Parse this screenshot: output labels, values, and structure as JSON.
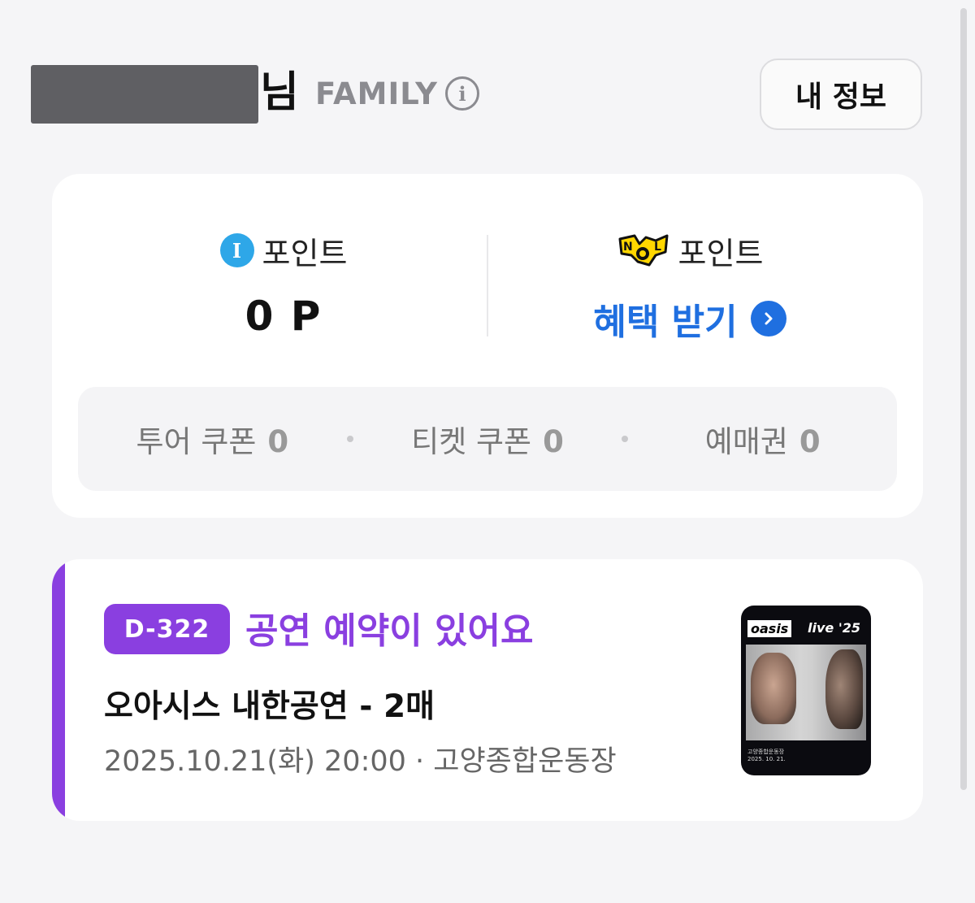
{
  "header": {
    "name_suffix": "님",
    "grade": "FAMILY",
    "info_icon_glyph": "i",
    "my_info_button": "내 정보"
  },
  "points": {
    "interpark": {
      "logo_glyph": "I",
      "label": "포인트",
      "value": "0 P"
    },
    "nol": {
      "logo_text": "NOL",
      "label": "포인트",
      "benefit_link": "혜택 받기"
    }
  },
  "coupons": [
    {
      "label": "투어 쿠폰",
      "count": "0"
    },
    {
      "label": "티켓 쿠폰",
      "count": "0"
    },
    {
      "label": "예매권",
      "count": "0"
    }
  ],
  "reservation": {
    "dday": "D-322",
    "heading": "공연 예약이 있어요",
    "title": "오아시스 내한공연 - 2매",
    "meta": "2025.10.21(화) 20:00 · 고양종합운동장",
    "poster": {
      "brand": "oasis",
      "live": "live '25",
      "fine_print": "고양종합운동장\n2025. 10. 21."
    }
  },
  "colors": {
    "accent_purple": "#8a3fe0",
    "link_blue": "#1f6fe0",
    "interpark_blue": "#2ea7e8",
    "nol_yellow": "#ffd600"
  },
  "icons": {
    "info": "info-circle-icon",
    "benefit_arrow": "chevron-right-circle-icon"
  }
}
